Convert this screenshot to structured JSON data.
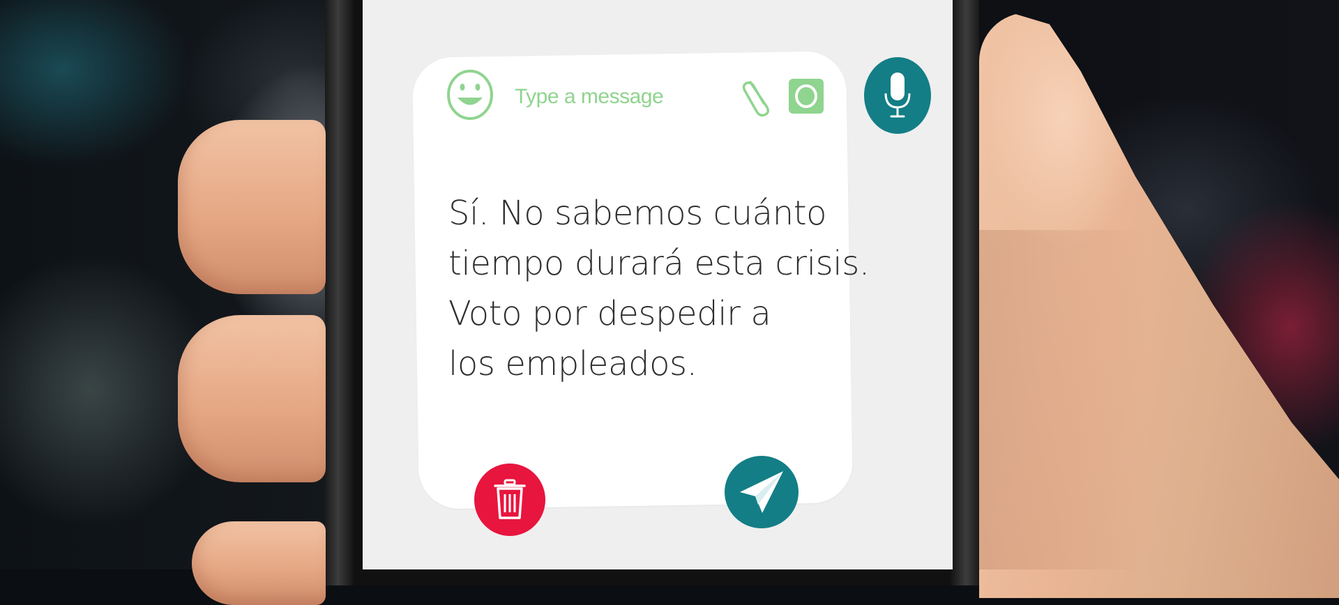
{
  "composer": {
    "placeholder": "Type a message"
  },
  "message": {
    "lines": [
      "Sí. No sabemos cuánto",
      "tiempo durará esta crisis.",
      "Voto por despedir a",
      "los empleados."
    ]
  },
  "icons": {
    "emoji": "smiley-face-icon",
    "attach": "paperclip-icon",
    "camera": "camera-icon",
    "mic": "microphone-icon",
    "delete": "trash-icon",
    "send": "paper-plane-icon"
  },
  "colors": {
    "accent_teal": "#137e86",
    "delete_red": "#e8153e",
    "icon_green": "#8fd48f",
    "text": "#2f2f2f",
    "card_bg": "#ffffff",
    "screen_bg": "#efefef"
  }
}
